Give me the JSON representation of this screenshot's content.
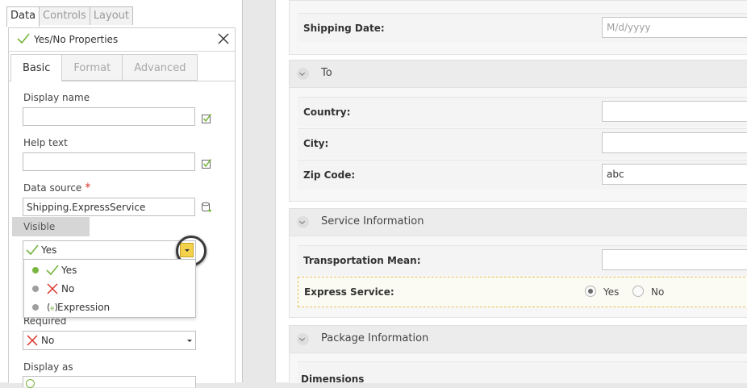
{
  "left_panel": {
    "top_tabs": [
      "Data",
      "Controls",
      "Layout"
    ],
    "properties_title": "Yes/No Properties",
    "sub_tabs": [
      "Basic",
      "Format",
      "Advanced"
    ],
    "display_name_label": "Display name",
    "display_name_value": "",
    "help_text_label": "Help text",
    "help_text_value": "",
    "data_source_label": "Data source",
    "data_source_required": "*",
    "data_source_value": "Shipping.ExpressService",
    "visible_label": "Visible",
    "visible_value": "Yes",
    "visible_options": [
      {
        "label": "Yes",
        "icon": "check-icon",
        "selected": true
      },
      {
        "label": "No",
        "icon": "cross-icon",
        "selected": false
      },
      {
        "label": "Expression",
        "icon": "expression-icon",
        "selected": false
      }
    ],
    "required_label": "Required",
    "required_value": "No",
    "display_as_label": "Display as"
  },
  "canvas": {
    "shipping_date_label": "Shipping Date:",
    "shipping_date_placeholder": "M/d/yyyy",
    "to_section": "To",
    "country_label": "Country:",
    "city_label": "City:",
    "zip_label": "Zip Code:",
    "zip_value": "abc",
    "service_section": "Service Information",
    "transport_label": "Transportation Mean:",
    "express_label": "Express Service:",
    "express_yes": "Yes",
    "express_no": "No",
    "express_selected": "Yes",
    "package_section": "Package Information",
    "dimensions_label": "Dimensions"
  },
  "colors": {
    "accent_yellow": "#f4d14a",
    "check_green": "#79b53f",
    "cross_red": "#d9342b"
  }
}
